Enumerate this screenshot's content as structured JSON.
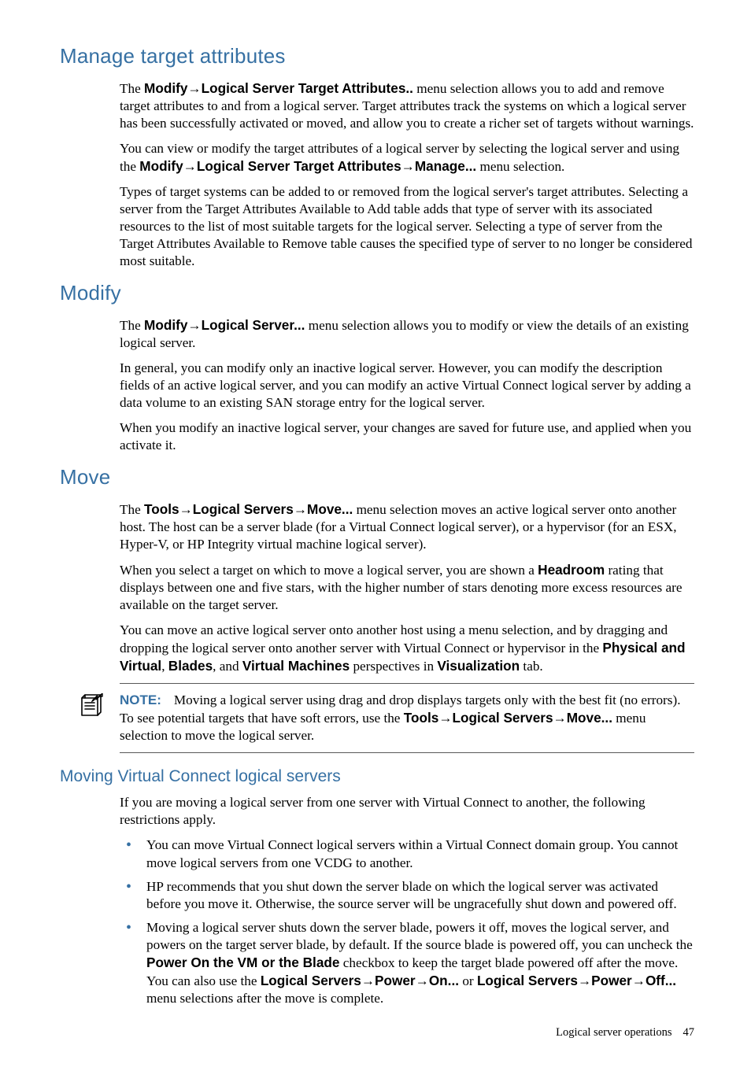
{
  "sections": {
    "s1": {
      "title": "Manage target attributes",
      "p1a": "The ",
      "p1b": "Modify",
      "p1c": "→",
      "p1d": "Logical Server Target Attributes..",
      "p1e": " menu selection allows you to add and remove target attributes to and from a logical server. Target attributes track the systems on which a logical server has been successfully activated or moved, and allow you to create a richer set of targets without warnings.",
      "p2a": "You can view or modify the target attributes of a logical server by selecting the logical server and using the ",
      "p2b": "Modify",
      "p2c": "→",
      "p2d": "Logical Server Target Attributes",
      "p2e": "→",
      "p2f": "Manage...",
      "p2g": " menu selection.",
      "p3": "Types of target systems can be added to or removed from the logical server's target attributes. Selecting a server from the Target Attributes Available to Add table adds that type of server with its associated resources to the list of most suitable targets for the logical server. Selecting a type of server from the Target Attributes Available to Remove table causes the specified type of server to no longer be considered most suitable."
    },
    "s2": {
      "title": "Modify",
      "p1a": "The ",
      "p1b": "Modify",
      "p1c": "→",
      "p1d": "Logical Server...",
      "p1e": " menu selection allows you to modify or view the details of an existing logical server.",
      "p2": "In general, you can modify only an inactive logical server. However, you can modify the description fields of an active logical server, and you can modify an active Virtual Connect logical server by adding a data volume to an existing SAN storage entry for the logical server.",
      "p3": "When you modify an inactive logical server, your changes are saved for future use, and applied when you activate it."
    },
    "s3": {
      "title": "Move",
      "p1a": "The ",
      "p1b": "Tools",
      "p1c": "→",
      "p1d": "Logical Servers",
      "p1e": "→",
      "p1f": "Move...",
      "p1g": " menu selection moves an active logical server onto another host. The host can be a server blade (for a Virtual Connect logical server), or a hypervisor (for an ESX, Hyper-V, or HP Integrity virtual machine logical server).",
      "p2a": "When you select a target on which to move a logical server, you are shown a ",
      "p2b": "Headroom",
      "p2c": " rating that displays between one and five stars, with the higher number of stars denoting more excess resources are available on the target server.",
      "p3a": "You can move an active logical server onto another host using a menu selection, and by dragging and dropping the logical server onto another server with Virtual Connect or hypervisor in the ",
      "p3b": "Physical and Virtual",
      "p3c": ", ",
      "p3d": "Blades",
      "p3e": ", and ",
      "p3f": "Virtual Machines",
      "p3g": " perspectives in ",
      "p3h": "Visualization",
      "p3i": " tab.",
      "note_label": "NOTE:",
      "note_a": "Moving a logical server using drag and drop displays targets only with the best fit (no errors). To see potential targets that have soft errors, use the ",
      "note_b": "Tools",
      "note_c": "→",
      "note_d": "Logical Servers",
      "note_e": "→",
      "note_f": "Move...",
      "note_g": " menu selection to move the logical server."
    },
    "s4": {
      "title": "Moving Virtual Connect logical servers",
      "intro": "If you are moving a logical server from one server with Virtual Connect to another, the following restrictions apply.",
      "li1": "You can move Virtual Connect logical servers within a Virtual Connect domain group. You cannot move logical servers from one VCDG to another.",
      "li2": "HP recommends that you shut down the server blade on which the logical server was activated before you move it. Otherwise, the source server will be ungracefully shut down and powered off.",
      "li3a": "Moving a logical server shuts down the server blade, powers it off, moves the logical server, and powers on the target server blade, by default. If the source blade is powered off, you can uncheck the ",
      "li3b": "Power On the VM or the Blade",
      "li3c": " checkbox to keep the target blade powered off after the move. You can also use the ",
      "li3d": "Logical Servers",
      "li3e": "→",
      "li3f": "Power",
      "li3g": "→",
      "li3h": "On...",
      "li3i": " or ",
      "li3j": "Logical Servers",
      "li3k": "→",
      "li3l": "Power",
      "li3m": "→",
      "li3n": "Off...",
      "li3o": " menu selections after the move is complete."
    }
  },
  "footer": {
    "text": "Logical server operations",
    "page": "47"
  }
}
